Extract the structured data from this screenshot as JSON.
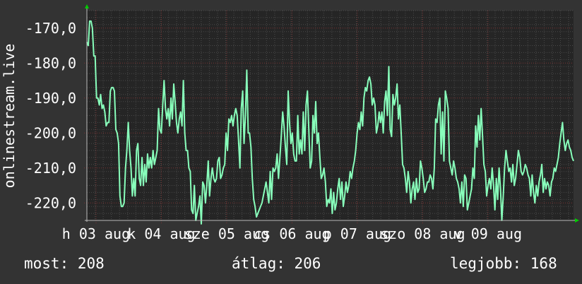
{
  "colors": {
    "background": "#333333",
    "plot_background": "#252525",
    "grid_major": "#7a3434",
    "grid_minor": "#4a4a4a",
    "line": "#88ffbb",
    "axis_arrow": "#00cc00",
    "text": "#ffffff"
  },
  "stats": {
    "current": "most: 208",
    "average": "átlag: 206",
    "best": "legjobb: 168"
  },
  "chart_data": {
    "type": "line",
    "ylabel": "onlinestream.live",
    "ylim": [
      -225,
      -165
    ],
    "yticks": [
      {
        "value": -170,
        "label": "-170,0"
      },
      {
        "value": -180,
        "label": "-180,0"
      },
      {
        "value": -190,
        "label": "-190,0"
      },
      {
        "value": -200,
        "label": "-200,0"
      },
      {
        "value": -210,
        "label": "-210,0"
      },
      {
        "value": -220,
        "label": "-220,0"
      }
    ],
    "xrange": [
      0,
      7.45
    ],
    "xticks": [
      {
        "value": 0.14,
        "label": "h 03 aug"
      },
      {
        "value": 1.14,
        "label": "k 04 aug"
      },
      {
        "value": 2.14,
        "label": "sze 05 aug"
      },
      {
        "value": 3.14,
        "label": "cs 06 aug"
      },
      {
        "value": 4.14,
        "label": "p 07 aug"
      },
      {
        "value": 5.14,
        "label": "szo 08 aug"
      },
      {
        "value": 6.14,
        "label": "v 09 aug"
      }
    ],
    "grid": true,
    "series": [
      {
        "values": [
          -174,
          -175,
          -168,
          -168,
          -170,
          -178,
          -178,
          -190,
          -190,
          -192,
          -189,
          -193,
          -192,
          -194,
          -198,
          -197,
          -197,
          -188,
          -187,
          -187,
          -188,
          -199,
          -200,
          -203,
          -218,
          -221,
          -221,
          -220,
          -210,
          -205,
          -197,
          -205,
          -210,
          -218,
          -213,
          -218,
          -205,
          -203,
          -213,
          -215,
          -207,
          -215,
          -209,
          -214,
          -206,
          -210,
          -207,
          -210,
          -205,
          -209,
          -207,
          -205,
          -193,
          -199,
          -200,
          -192,
          -185,
          -193,
          -196,
          -193,
          -198,
          -190,
          -196,
          -186,
          -191,
          -197,
          -200,
          -196,
          -194,
          -198,
          -185,
          -200,
          -205,
          -205,
          -210,
          -211,
          -222,
          -223,
          -215,
          -225,
          -223,
          -221,
          -218,
          -226,
          -214,
          -215,
          -220,
          -215,
          -208,
          -218,
          -213,
          -210,
          -213,
          -214,
          -213,
          -208,
          -207,
          -213,
          -212,
          -210,
          -209,
          -200,
          -205,
          -196,
          -197,
          -195,
          -198,
          -195,
          -193,
          -195,
          -202,
          -210,
          -193,
          -188,
          -203,
          -195,
          -182,
          -200,
          -200,
          -204,
          -213,
          -219,
          -221,
          -224,
          -223,
          -222,
          -221,
          -220,
          -218,
          -216,
          -214,
          -217,
          -220,
          -211,
          -219,
          -210,
          -211,
          -210,
          -206,
          -213,
          -207,
          -201,
          -194,
          -198,
          -204,
          -209,
          -188,
          -197,
          -203,
          -200,
          -206,
          -208,
          -208,
          -195,
          -206,
          -202,
          -206,
          -194,
          -205,
          -192,
          -188,
          -199,
          -210,
          -208,
          -195,
          -200,
          -191,
          -203,
          -200,
          -207,
          -213,
          -212,
          -210,
          -214,
          -221,
          -219,
          -220,
          -216,
          -223,
          -217,
          -222,
          -220,
          -216,
          -213,
          -219,
          -214,
          -221,
          -218,
          -214,
          -217,
          -215,
          -211,
          -213,
          -210,
          -208,
          -205,
          -200,
          -197,
          -199,
          -194,
          -198,
          -190,
          -187,
          -188,
          -185,
          -184,
          -186,
          -192,
          -190,
          -192,
          -200,
          -198,
          -194,
          -197,
          -194,
          -200,
          -191,
          -188,
          -195,
          -181,
          -199,
          -201,
          -189,
          -192,
          -190,
          -186,
          -196,
          -192,
          -200,
          -209,
          -210,
          -213,
          -217,
          -211,
          -214,
          -220,
          -216,
          -214,
          -219,
          -213,
          -217,
          -216,
          -208,
          -210,
          -213,
          -217,
          -216,
          -214,
          -214,
          -212,
          -213,
          -216,
          -210,
          -196,
          -197,
          -192,
          -190,
          -206,
          -194,
          -208,
          -188,
          -190,
          -193,
          -208,
          -210,
          -212,
          -208,
          -210,
          -213,
          -214,
          -216,
          -220,
          -214,
          -221,
          -212,
          -213,
          -222,
          -220,
          -218,
          -216,
          -210,
          -213,
          -198,
          -204,
          -195,
          -202,
          -193,
          -201,
          -209,
          -211,
          -218,
          -215,
          -213,
          -216,
          -210,
          -215,
          -222,
          -213,
          -219,
          -210,
          -216,
          -225,
          -218,
          -210,
          -205,
          -208,
          -211,
          -210,
          -214,
          -209,
          -215,
          -213,
          -209,
          -205,
          -207,
          -211,
          -212,
          -211,
          -209,
          -210,
          -212,
          -213,
          -218,
          -212,
          -217,
          -220,
          -215,
          -218,
          -214,
          -212,
          -209,
          -217,
          -213,
          -216,
          -214,
          -215,
          -218,
          -214,
          -213,
          -210,
          -211,
          -209,
          -207,
          -203,
          -200,
          -197,
          -202,
          -205,
          -203,
          -202,
          -204,
          -205,
          -207,
          -208
        ]
      }
    ]
  }
}
